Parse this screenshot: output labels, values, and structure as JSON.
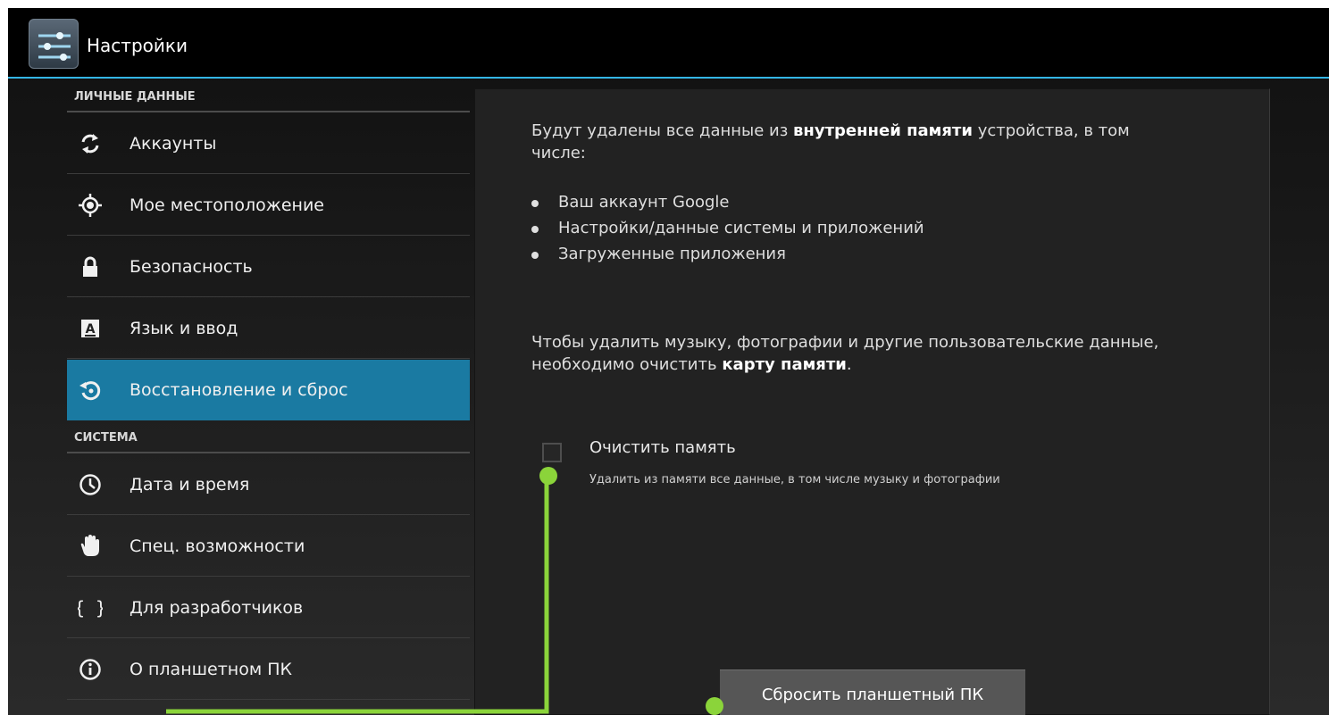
{
  "app": {
    "title": "Настройки",
    "icon": "settings-sliders-icon"
  },
  "sidebar": {
    "category_personal": "ЛИЧНЫЕ ДАННЫЕ",
    "category_system": "СИСТЕМА",
    "items": [
      {
        "label": "Аккаунты",
        "icon": "sync-icon"
      },
      {
        "label": "Мое местоположение",
        "icon": "location-icon"
      },
      {
        "label": "Безопасность",
        "icon": "lock-icon"
      },
      {
        "label": "Язык и ввод",
        "icon": "keyboard-letter-icon"
      },
      {
        "label": "Восстановление и сброс",
        "icon": "restore-icon",
        "selected": true
      },
      {
        "label": "Дата и время",
        "icon": "clock-icon"
      },
      {
        "label": "Спец. возможности",
        "icon": "hand-icon"
      },
      {
        "label": "Для разработчиков",
        "icon": "braces-icon"
      },
      {
        "label": "О планшетном ПК",
        "icon": "info-icon"
      }
    ]
  },
  "detail": {
    "intro_prefix": "Будут удалены все данные из ",
    "intro_bold": "внутренней памяти",
    "intro_suffix": " устройства, в том числе:",
    "bullets": [
      "Ваш аккаунт Google",
      "Настройки/данные системы и приложений",
      "Загруженные приложения"
    ],
    "sd_prefix": "Чтобы удалить музыку, фотографии и другие пользовательские данные, необходимо очистить ",
    "sd_bold": "карту памяти",
    "sd_suffix": ".",
    "erase_title": "Очистить память",
    "erase_summary": "Удалить из памяти все данные, в том числе музыку и фотографии",
    "erase_checked": false,
    "reset_button": "Сбросить планшетный ПК"
  },
  "colors": {
    "accent": "#33b5e5",
    "selected": "#1a7aa2",
    "annotation": "#8bd43a"
  }
}
